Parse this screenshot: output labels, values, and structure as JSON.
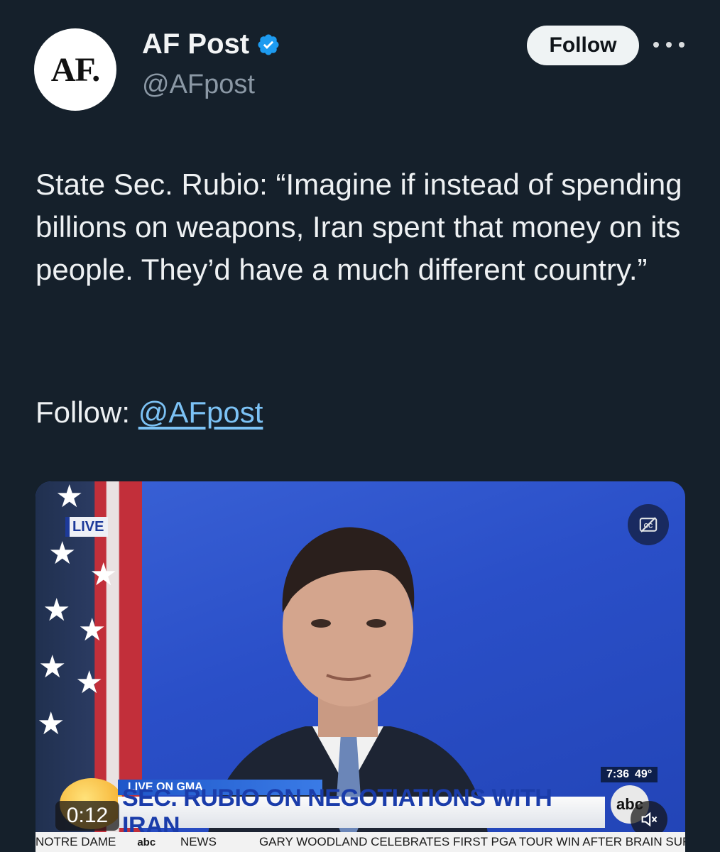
{
  "author": {
    "avatar_text": "AF.",
    "display_name": "AF Post",
    "handle": "@AFpost",
    "verified": true
  },
  "actions": {
    "follow_label": "Follow",
    "more_icon": "more-horizontal-icon"
  },
  "tweet": {
    "text": "State Sec. Rubio: “Imagine if instead of spending billions on weapons, Iran spent that money on its people. They’d have a much different country.”",
    "follow_prefix": "Follow: ",
    "follow_link": "@AFpost"
  },
  "video": {
    "live_badge": "LIVE",
    "lower_third_top": "LIVE ON GMA",
    "lower_third_main": "SEC. RUBIO ON NEGOTIATIONS WITH IRAN",
    "elapsed": "0:12",
    "clock_time": "7:36",
    "clock_temp": "49°",
    "network_logo": "abc",
    "ticker": [
      "NOTRE DAME",
      "NEWS",
      "GARY WOODLAND CELEBRATES FIRST PGA TOUR WIN AFTER BRAIN SURGERY"
    ],
    "ticker_network": "abc",
    "cc_icon": "closed-captions-off-icon",
    "mute_icon": "muted-speaker-icon"
  },
  "colors": {
    "background": "#15202b",
    "link": "#7cc2f5",
    "verified": "#1d9bf0"
  }
}
